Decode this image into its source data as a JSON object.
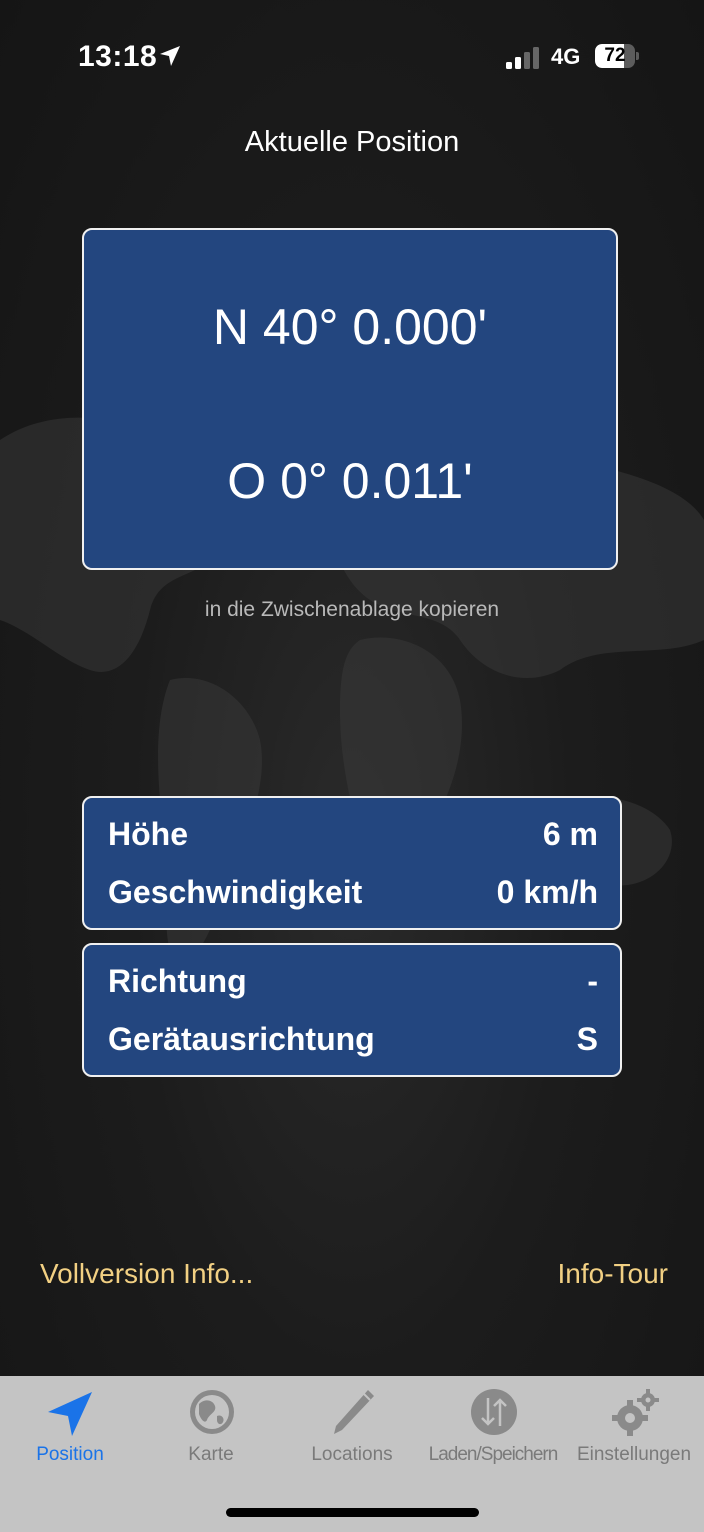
{
  "status_bar": {
    "time": "13:18",
    "network": "4G",
    "battery": "72",
    "battery_level": 0.72,
    "icons": [
      "location-arrow-icon",
      "signal-icon",
      "battery-icon"
    ]
  },
  "header": {
    "title": "Aktuelle Position"
  },
  "coordinates": {
    "latitude": "N 40° 0.000'",
    "longitude": "O 0° 0.011'",
    "copy_label": "in die Zwischenablage kopieren"
  },
  "motion_info": {
    "altitude_label": "Höhe",
    "altitude_value": "6 m",
    "speed_label": "Geschwindigkeit",
    "speed_value": "0 km/h"
  },
  "direction_info": {
    "heading_label": "Richtung",
    "heading_value": "-",
    "device_orientation_label": "Gerätausrichtung",
    "device_orientation_value": "S"
  },
  "links": {
    "full_version": "Vollversion Info...",
    "tour": "Info-Tour"
  },
  "tabs": [
    {
      "label": "Position",
      "icon": "navigation-arrow-icon",
      "active": true
    },
    {
      "label": "Karte",
      "icon": "globe-icon",
      "active": false
    },
    {
      "label": "Locations",
      "icon": "pencil-icon",
      "active": false
    },
    {
      "label": "Laden/Speichern",
      "icon": "load-save-arrows-icon",
      "active": false
    },
    {
      "label": "Einstellungen",
      "icon": "gears-icon",
      "active": false
    }
  ],
  "colors": {
    "background": "#1c1c1c",
    "box": "#23467f",
    "link": "#f2d083",
    "tabbar": "#c4c4c4",
    "active_tab": "#1a73e8",
    "inactive_tab": "#7a7a7a"
  }
}
